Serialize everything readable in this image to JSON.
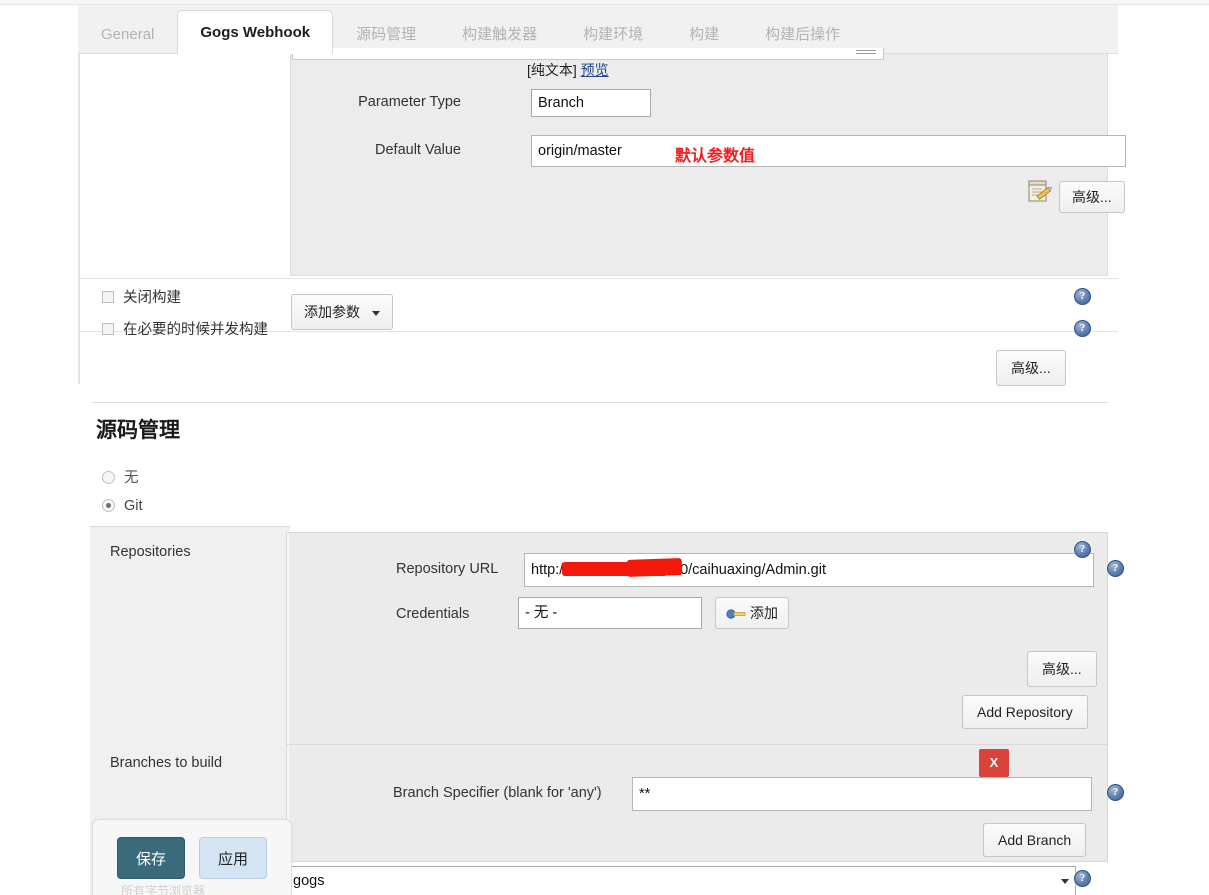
{
  "tabs": [
    {
      "label": "General",
      "active": false
    },
    {
      "label": "Gogs Webhook",
      "active": true
    },
    {
      "label": "源码管理",
      "active": false
    },
    {
      "label": "构建触发器",
      "active": false
    },
    {
      "label": "构建环境",
      "active": false
    },
    {
      "label": "构建",
      "active": false
    },
    {
      "label": "构建后操作",
      "active": false
    }
  ],
  "parameter_block": {
    "plaintext_label": "[纯文本]",
    "preview_link": "预览",
    "parameter_type_label": "Parameter Type",
    "parameter_type_value": "Branch",
    "default_value_label": "Default Value",
    "default_value": "origin/master",
    "annotation": "默认参数值",
    "advanced_button": "高级...",
    "add_parameter_button": "添加参数"
  },
  "build_options": {
    "disable_build_label": "关闭构建",
    "disable_build_checked": false,
    "concurrent_build_label": "在必要的时候并发构建",
    "concurrent_build_checked": false,
    "advanced_button": "高级..."
  },
  "scm": {
    "title": "源码管理",
    "options": [
      {
        "label": "无",
        "selected": false
      },
      {
        "label": "Git",
        "selected": true
      }
    ],
    "repositories_label": "Repositories",
    "repository_url_label": "Repository URL",
    "repository_url_value": "http://xxx.xxx.x.xxx:3000/caihuaxing/Admin.git",
    "repository_url_prefix": "http",
    "repository_url_suffix": ":3000/caihuaxing/Admin.git",
    "credentials_label": "Credentials",
    "credentials_value": "- 无 -",
    "add_credentials_button": "添加",
    "advanced_button": "高级...",
    "add_repository_button": "Add Repository",
    "branches_label": "Branches to build",
    "branch_specifier_label": "Branch Specifier (blank for 'any')",
    "branch_specifier_value": "**",
    "delete_branch_button": "X",
    "add_branch_button": "Add Branch",
    "repository_browser_value": "gogs"
  },
  "footer": {
    "save_button": "保存",
    "apply_button": "应用",
    "ghost_text": "所有字节浏览器"
  },
  "icons": {
    "help": "?",
    "notepad": "notepad-pencil-icon",
    "key": "key-icon"
  },
  "colors": {
    "accent_save": "#3a6b7d",
    "accent_apply": "#d4e4f2",
    "delete_red": "#d9433a",
    "annotation_red": "#ee2222",
    "help_blue": "#5d7fb0",
    "panel_grey": "#ececec"
  }
}
